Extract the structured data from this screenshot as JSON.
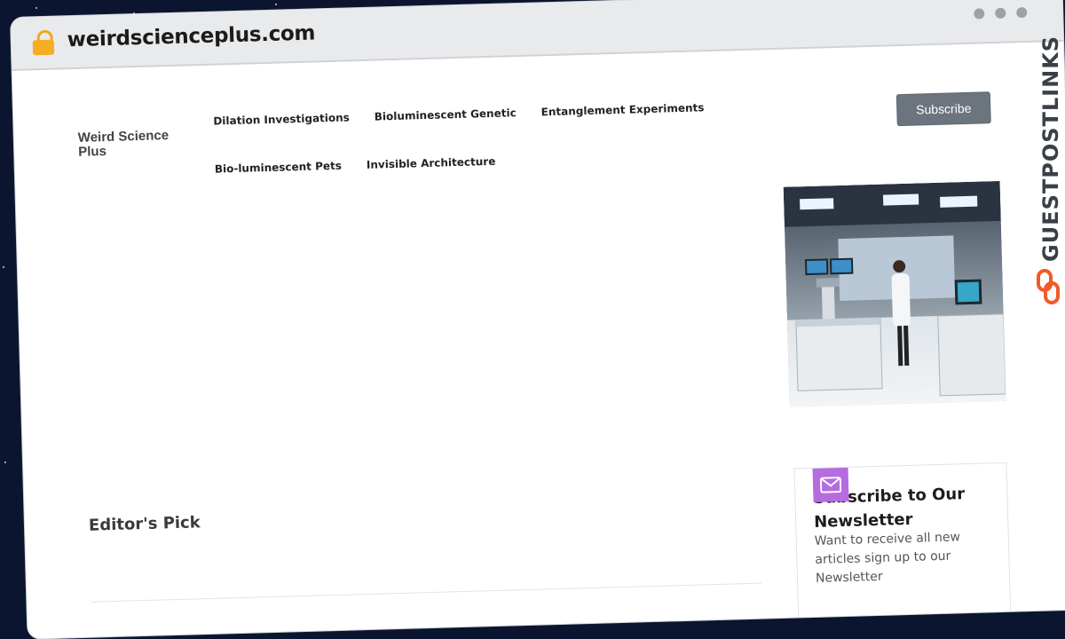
{
  "browser": {
    "url": "weirdscienceplus.com"
  },
  "site": {
    "logo": "Weird Science Plus",
    "nav": [
      "Dilation Investigations",
      "Bioluminescent Genetic",
      "Entanglement Experiments",
      "Bio-luminescent Pets",
      "Invisible Architecture"
    ],
    "subscribe_label": "Subscribe"
  },
  "hero": {
    "image": "scientist in laboratory photo"
  },
  "main": {
    "section_heading": "Editor's Pick"
  },
  "newsletter": {
    "icon": "mail-icon",
    "title": "Subscribe to Our Newsletter",
    "text": "Want to receive all new articles sign up to our Newsletter"
  },
  "watermark": {
    "text": "GUESTPOSTLINKS"
  },
  "colors": {
    "subscribe_button": "#6c757d",
    "mail_badge": "#b56ce0",
    "lock": "#f6ad24",
    "background": "#0b1530"
  }
}
